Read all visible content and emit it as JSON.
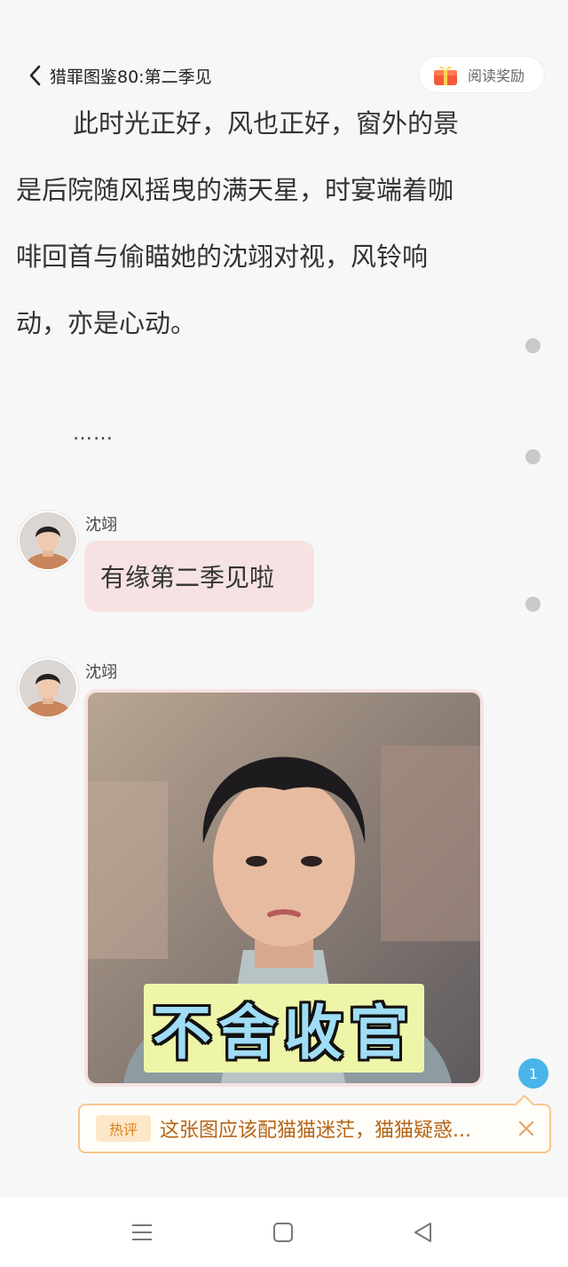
{
  "header": {
    "book_title": "猎罪图鉴80:第二季见",
    "reward_label": "阅读奖励",
    "icons": {
      "back": "chevron-left-icon",
      "reward": "gift-box-icon"
    }
  },
  "story": {
    "paragraph_lines": [
      "此时光正好，风也正好，窗外的景",
      "是后院随风摇曳的满天星，时宴端着咖",
      "啡回首与偷瞄她的沈翊对视，风铃响",
      "动，亦是心动。"
    ],
    "ellipsis": "……",
    "messages": [
      {
        "speaker": "沈翊",
        "text": "有缘第二季见啦"
      },
      {
        "speaker": "沈翊",
        "image_caption": "不舍收官"
      }
    ]
  },
  "hot_comment": {
    "tag": "热评",
    "text": "这张图应该配猫猫迷茫，猫猫疑惑...",
    "count": "1"
  },
  "colors": {
    "bubble": "#f6e2e2",
    "hot_border": "#f5c58e",
    "hot_text": "#b56418",
    "badge": "#48b4ea"
  },
  "navbar": {
    "icons": [
      "menu-icon",
      "home-square-icon",
      "back-triangle-icon"
    ]
  }
}
